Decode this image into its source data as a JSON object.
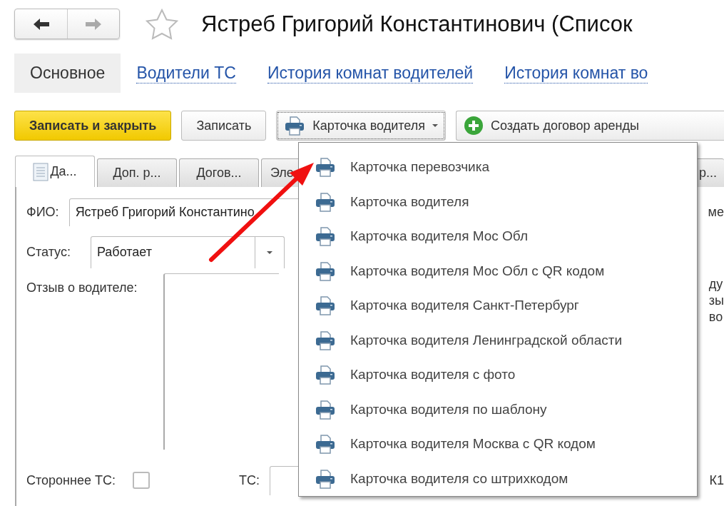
{
  "nav": [
    {
      "kind": "back",
      "disabled": false
    },
    {
      "kind": "forward",
      "disabled": true
    }
  ],
  "title": "Ястреб Григорий Константинович (Список",
  "sections": [
    {
      "label": "Основное",
      "selected": true
    },
    {
      "label": "Водители ТС",
      "selected": false
    },
    {
      "label": "История комнат водителей",
      "selected": false
    },
    {
      "label": "История комнат во",
      "selected": false
    }
  ],
  "toolbar": [
    {
      "label": "Записать и закрыть",
      "kind": "default"
    },
    {
      "label": "Записать",
      "kind": "plain"
    },
    {
      "label": "Карточка водителя",
      "kind": "print-menu"
    },
    {
      "label": "Создать договор аренды",
      "kind": "create"
    }
  ],
  "form_tabs": [
    {
      "label": "Да...",
      "selected": true
    },
    {
      "label": "Доп. р...",
      "selected": false
    },
    {
      "label": "Догов...",
      "selected": false
    },
    {
      "label": "Эле",
      "selected": false
    },
    {
      "label": "р...",
      "selected": false
    }
  ],
  "fio": {
    "label": "ФИО:",
    "value": "Ястреб Григорий Константино"
  },
  "status": {
    "label": "Статус:",
    "value": "Работает"
  },
  "review": {
    "label": "Отзыв о водителе:"
  },
  "third_party": {
    "label": "Стороннее ТС:",
    "checked": false
  },
  "vehicle": {
    "label": "ТС:"
  },
  "right_fragments": [
    "ме",
    "ду",
    "зы",
    "во",
    "К1"
  ],
  "print_menu": {
    "items": [
      {
        "label": "Карточка перевозчика"
      },
      {
        "label": "Карточка водителя"
      },
      {
        "label": "Карточка водителя Мос Обл"
      },
      {
        "label": "Карточка водителя Мос Обл с QR кодом"
      },
      {
        "label": "Карточка водителя Санкт-Петербург"
      },
      {
        "label": "Карточка водителя Ленинградской области"
      },
      {
        "label": "Карточка водителя с фото"
      },
      {
        "label": "Карточка водителя по шаблону"
      },
      {
        "label": "Карточка водителя Москва с QR кодом"
      },
      {
        "label": "Карточка водителя со штрихкодом"
      }
    ]
  }
}
